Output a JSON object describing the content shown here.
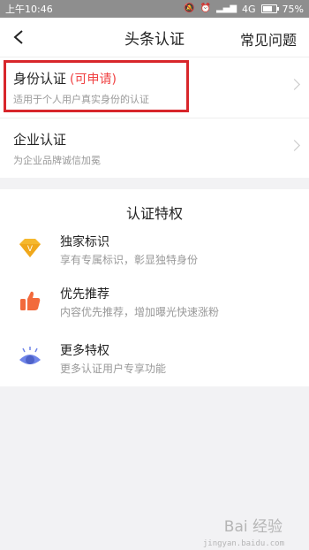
{
  "status_bar": {
    "time": "上午10:46",
    "network": "4G",
    "battery": "75%",
    "battery_level": 0.75
  },
  "nav": {
    "title": "头条认证",
    "faq": "常见问题"
  },
  "certifications": [
    {
      "title": "身份认证",
      "badge": "(可申请)",
      "desc": "适用于个人用户真实身份的认证"
    },
    {
      "title": "企业认证",
      "badge": "",
      "desc": "为企业品牌诚信加冕"
    }
  ],
  "privileges": {
    "title": "认证特权",
    "items": [
      {
        "icon": "diamond-v-icon",
        "name": "独家标识",
        "desc": "享有专属标识，彰显独特身份"
      },
      {
        "icon": "thumbs-up-icon",
        "name": "优先推荐",
        "desc": "内容优先推荐，增加曝光快速涨粉"
      },
      {
        "icon": "eye-icon",
        "name": "更多特权",
        "desc": "更多认证用户专享功能"
      }
    ]
  },
  "watermark": {
    "brand": "Bai 经验",
    "sub": "jingyan.baidu.com"
  },
  "colors": {
    "accent": "#f04142",
    "highlight": "#d8262b",
    "gold": "#f5b82e",
    "orange": "#f26a3c",
    "blue": "#6f84e8"
  }
}
